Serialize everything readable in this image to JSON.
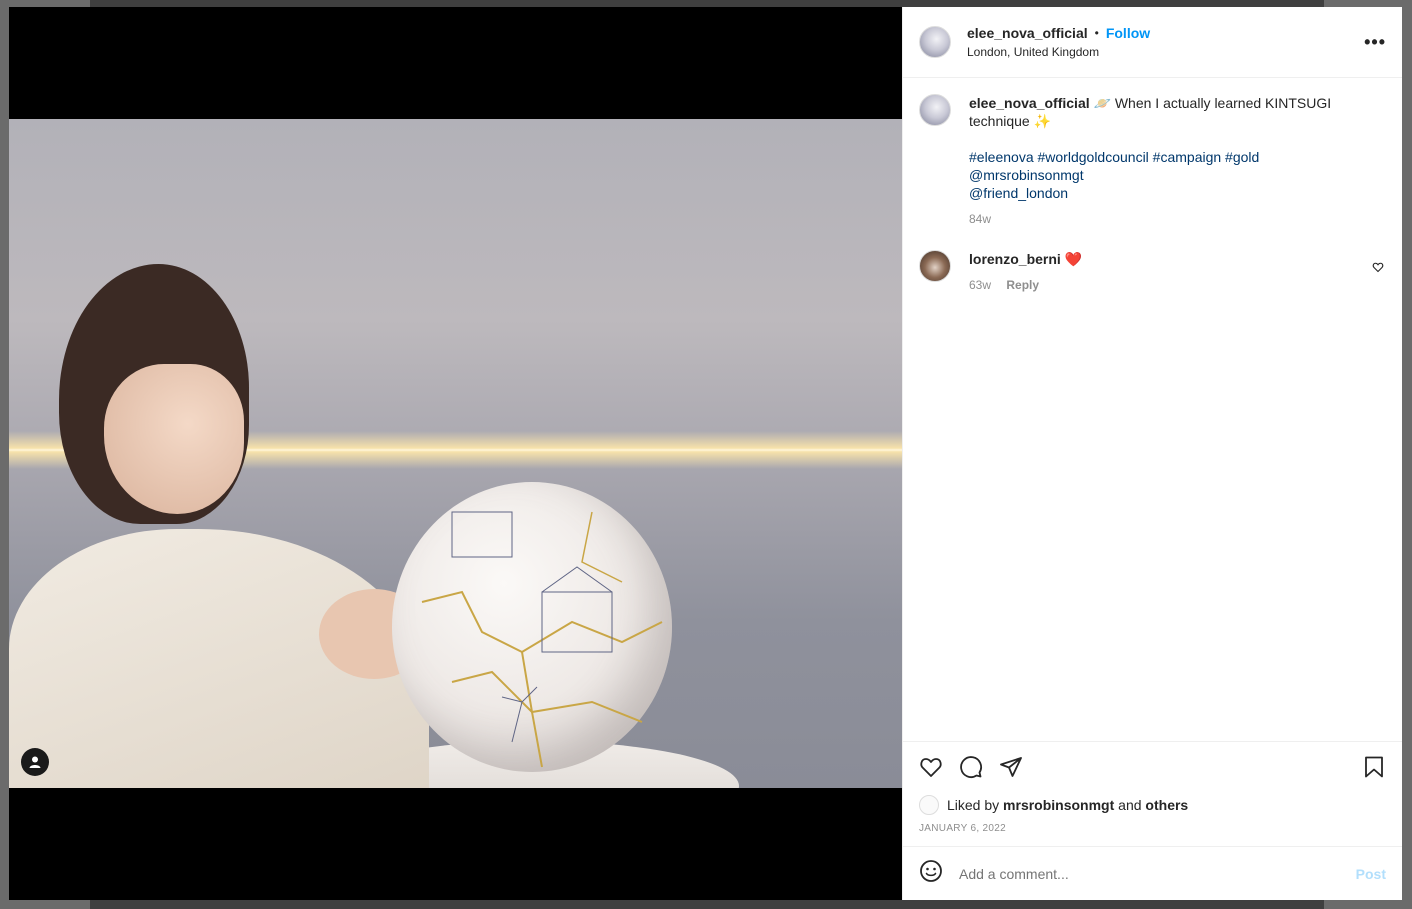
{
  "post": {
    "username": "elee_nova_official",
    "separator": "•",
    "follow_label": "Follow",
    "location": "London, United Kingdom",
    "more_label": "•••"
  },
  "caption": {
    "username": "elee_nova_official",
    "emoji_1": "🪐",
    "text_1": "When I actually learned KINTSUGI technique",
    "emoji_2": "✨",
    "hashtags": "#eleenova #worldgoldcouncil #campaign #gold",
    "mention_1": "@mrsrobinsonmgt",
    "mention_2": "@friend_london",
    "age": "84w"
  },
  "comments": [
    {
      "username": "lorenzo_berni",
      "text": "❤️",
      "age": "63w",
      "reply_label": "Reply"
    }
  ],
  "likes": {
    "prefix": "Liked by",
    "user": "mrsrobinsonmgt",
    "and": "and",
    "others": "others",
    "date": "JANUARY 6, 2022"
  },
  "comment_box": {
    "placeholder": "Add a comment...",
    "post_label": "Post"
  },
  "icons": {
    "like": "heart-icon",
    "comment": "comment-icon",
    "share": "paper-plane-icon",
    "save": "bookmark-icon",
    "emoji": "smiley-icon",
    "tag": "user-tag-icon"
  },
  "colors": {
    "follow": "#0095f6",
    "link": "#00376b",
    "heart": "#ed4956",
    "post_disabled": "#b2dffc"
  }
}
